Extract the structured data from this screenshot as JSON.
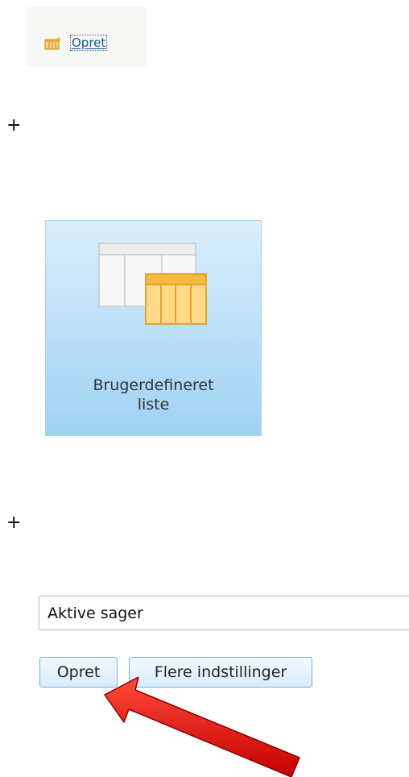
{
  "toolbar": {
    "create_label": "Opret",
    "create_icon": "table-create-icon"
  },
  "plus_signs": [
    "+",
    "+"
  ],
  "app_tile": {
    "label": "Brugerdefineret\nliste",
    "icon": "custom-list-icon"
  },
  "form": {
    "name_value": "Aktive sager",
    "create_button": "Opret",
    "more_options_button": "Flere indstillinger"
  },
  "annotation": {
    "arrow_icon": "red-arrow-icon",
    "arrow_color": "#e11212"
  }
}
